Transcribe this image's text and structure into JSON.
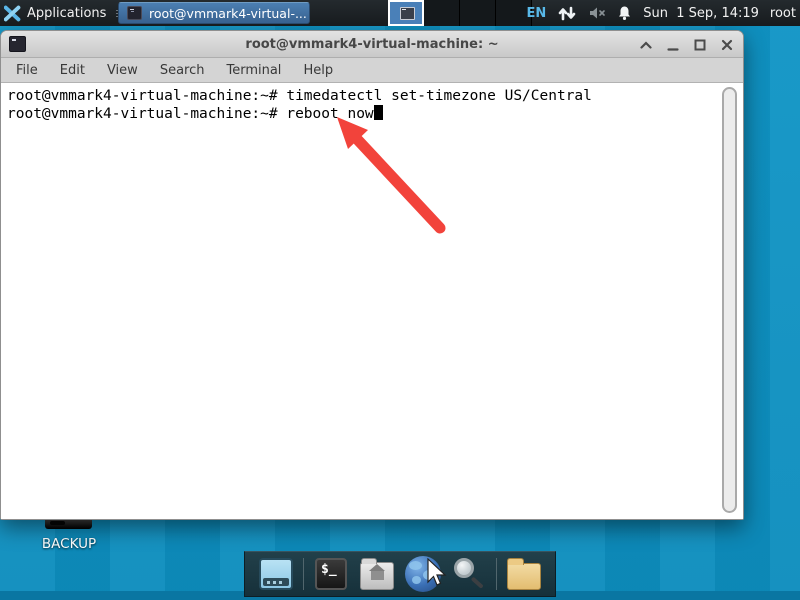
{
  "panel": {
    "applications_label": "Applications",
    "taskbar_button_label": "root@vmmark4-virtual-...",
    "language_indicator": "EN",
    "clock": "Sun  1 Sep, 14:19",
    "user": "root"
  },
  "window": {
    "title": "root@vmmark4-virtual-machine: ~",
    "menu": [
      "File",
      "Edit",
      "View",
      "Search",
      "Terminal",
      "Help"
    ],
    "terminal_lines": [
      "root@vmmark4-virtual-machine:~# timedatectl set-timezone US/Central",
      "root@vmmark4-virtual-machine:~# reboot now"
    ]
  },
  "desktop": {
    "backup_label": "BACKUP"
  },
  "dock": {
    "terminal_glyph": "$_"
  },
  "colors": {
    "desktop_teal": "#0e8fc0",
    "panel_background": "#1a1f23",
    "taskbar_active_blue": "#4a80b8",
    "language_indicator_blue": "#58b8e8",
    "annotation_arrow_red": "#f2433b",
    "titlebar_gray": "#d6d6d6",
    "folder_tan": "#e9c87f"
  }
}
